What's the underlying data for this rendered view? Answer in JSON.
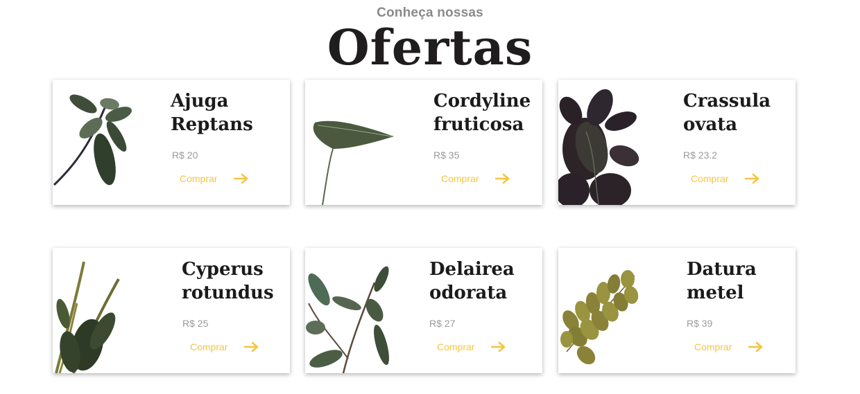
{
  "section": {
    "subtitle": "Conheça nossas",
    "title": "Ofertas"
  },
  "colors": {
    "accent": "#f5c542",
    "title": "#1f1d1d",
    "price": "#9a9a9a"
  },
  "products": [
    {
      "name_line1": "Ajuga",
      "name_line2": "Reptans",
      "price": "R$ 20",
      "buy_label": "Comprar",
      "icon": "arrow-right-icon"
    },
    {
      "name_line1": "Cordyline",
      "name_line2": "fruticosa",
      "price": "R$ 35",
      "buy_label": "Comprar",
      "icon": "arrow-right-icon"
    },
    {
      "name_line1": "Crassula",
      "name_line2": "ovata",
      "price": "R$ 23.2",
      "buy_label": "Comprar",
      "icon": "arrow-right-icon"
    },
    {
      "name_line1": "Cyperus",
      "name_line2": "rotundus",
      "price": "R$ 25",
      "buy_label": "Comprar",
      "icon": "arrow-right-icon"
    },
    {
      "name_line1": "Delairea",
      "name_line2": "odorata",
      "price": "R$ 27",
      "buy_label": "Comprar",
      "icon": "arrow-right-icon"
    },
    {
      "name_line1": "Datura",
      "name_line2": "metel",
      "price": "R$ 39",
      "buy_label": "Comprar",
      "icon": "arrow-right-icon"
    }
  ]
}
